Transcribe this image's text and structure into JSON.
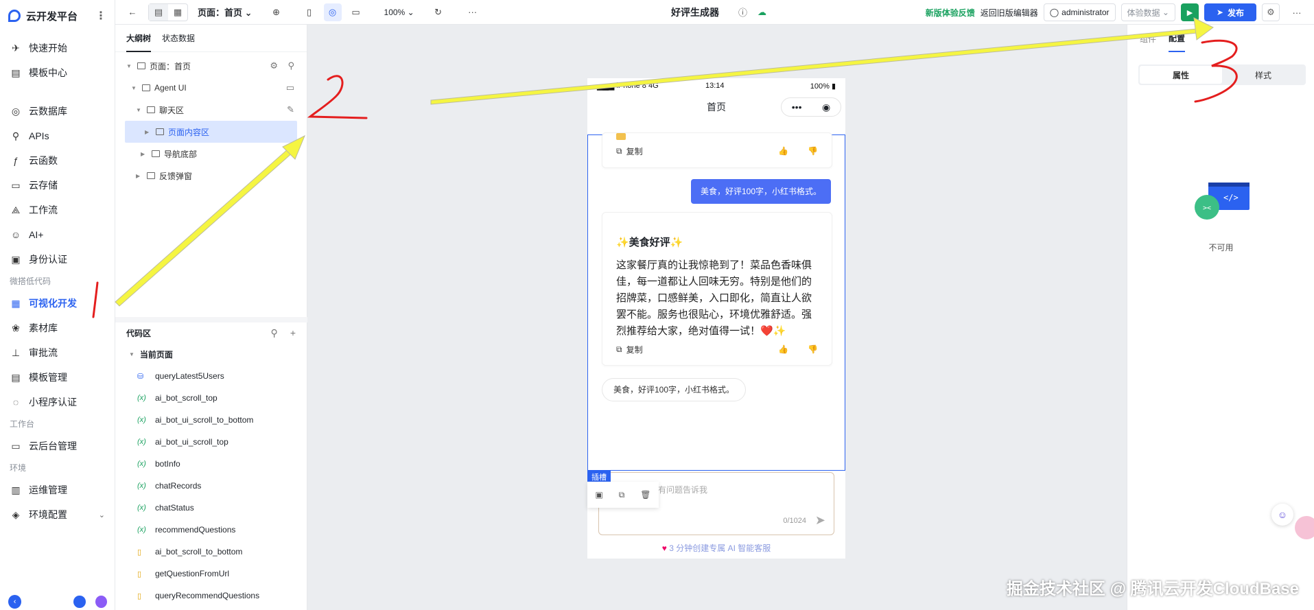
{
  "nav": {
    "brand": "云开发平台",
    "items_top": [
      {
        "label": "快速开始",
        "icon": "rocket-icon",
        "glyph": "✈"
      },
      {
        "label": "模板中心",
        "icon": "template-icon",
        "glyph": "▤"
      }
    ],
    "items_main": [
      {
        "label": "云数据库",
        "icon": "database-icon",
        "glyph": "◎"
      },
      {
        "label": "APIs",
        "icon": "link-icon",
        "glyph": "⚲"
      },
      {
        "label": "云函数",
        "icon": "function-icon",
        "glyph": "ƒ"
      },
      {
        "label": "云存储",
        "icon": "storage-icon",
        "glyph": "▭"
      },
      {
        "label": "工作流",
        "icon": "workflow-icon",
        "glyph": "⟁"
      },
      {
        "label": "AI+",
        "icon": "robot-icon",
        "glyph": "☺"
      },
      {
        "label": "身份认证",
        "icon": "id-card-icon",
        "glyph": "▣"
      }
    ],
    "section_lowcode": "微搭低代码",
    "items_lowcode": [
      {
        "label": "可视化开发",
        "icon": "visual-dev-icon",
        "glyph": "▦",
        "active": true
      },
      {
        "label": "素材库",
        "icon": "assets-icon",
        "glyph": "❀"
      },
      {
        "label": "审批流",
        "icon": "approval-icon",
        "glyph": "⊥"
      },
      {
        "label": "模板管理",
        "icon": "template-manage-icon",
        "glyph": "▤"
      },
      {
        "label": "小程序认证",
        "icon": "miniprogram-icon",
        "glyph": "◌"
      }
    ],
    "section_workbench": "工作台",
    "items_workbench": [
      {
        "label": "云后台管理",
        "icon": "monitor-icon",
        "glyph": "▭"
      }
    ],
    "section_env": "环境",
    "items_env": [
      {
        "label": "运维管理",
        "icon": "ops-chart-icon",
        "glyph": "▥"
      },
      {
        "label": "环境配置",
        "icon": "env-config-icon",
        "glyph": "◈"
      }
    ]
  },
  "toolbar": {
    "page_select": "页面：首页",
    "zoom": "100%",
    "title": "好评生成器",
    "feedback": "新版体验反馈",
    "old_editor": "返回旧版编辑器",
    "user": "administrator",
    "exp_data": "体验数据",
    "publish": "发布"
  },
  "outline": {
    "tab_tree": "大纲树",
    "tab_state": "状态数据",
    "nodes": [
      {
        "label": "页面：首页",
        "depth": 0
      },
      {
        "label": "Agent UI",
        "depth": 1
      },
      {
        "label": "聊天区",
        "depth": 2
      },
      {
        "label": "页面内容区",
        "depth": 3,
        "selected": true
      },
      {
        "label": "导航底部",
        "depth": 3
      },
      {
        "label": "反馈弹窗",
        "depth": 2
      }
    ]
  },
  "code": {
    "title": "代码区",
    "current_page": "当前页面",
    "items": [
      {
        "label": "queryLatest5Users",
        "kind": "db",
        "glyph": "⛁"
      },
      {
        "label": "ai_bot_scroll_top",
        "kind": "var",
        "glyph": "(x)"
      },
      {
        "label": "ai_bot_ui_scroll_to_bottom",
        "kind": "var",
        "glyph": "(x)"
      },
      {
        "label": "ai_bot_ui_scroll_top",
        "kind": "var",
        "glyph": "(x)"
      },
      {
        "label": "botInfo",
        "kind": "var",
        "glyph": "(x)"
      },
      {
        "label": "chatRecords",
        "kind": "var",
        "glyph": "(x)"
      },
      {
        "label": "chatStatus",
        "kind": "var",
        "glyph": "(x)"
      },
      {
        "label": "recommendQuestions",
        "kind": "var",
        "glyph": "(x)"
      },
      {
        "label": "ai_bot_scroll_to_bottom",
        "kind": "fn",
        "glyph": "▯"
      },
      {
        "label": "getQuestionFromUrl",
        "kind": "fn",
        "glyph": "▯"
      },
      {
        "label": "queryRecommendQuestions",
        "kind": "fn",
        "glyph": "▯"
      }
    ]
  },
  "phone": {
    "carrier": "iPhone 8",
    "network": "4G",
    "time": "13:14",
    "battery": "100%",
    "nav_title": "首页",
    "copy_label": "复制",
    "user_message": "美食，好评100字，小红书格式。",
    "ai_title": "✨美食好评✨",
    "ai_body": "这家餐厅真的让我惊艳到了！菜品色香味俱佳，每一道都让人回味无穷。特别是他们的招牌菜，口感鲜美，入口即化，简直让人欲罢不能。服务也很贴心，环境优雅舒适。强烈推荐给大家，绝对值得一试！❤️✨",
    "suggestion": "美食，好评100字，小红书格式。",
    "slot_tag": "插槽",
    "input_placeholder": "有问题告诉我",
    "input_count": "0/1024",
    "promo": "3 分钟创建专属 AI 智能客服"
  },
  "rpanel": {
    "tab_component": "组件",
    "tab_config": "配置",
    "seg_props": "属性",
    "seg_style": "样式",
    "empty": "不可用"
  },
  "annotations": {
    "mark1": "1",
    "mark2": "2",
    "mark3": "3"
  },
  "watermark": "掘金技术社区 @ 腾讯云开发CloudBase",
  "colors": {
    "primary": "#2b62f0",
    "success": "#19a15f",
    "highlight": "#dbe6ff",
    "arrow": "#f5f542",
    "annotation": "#e41e1e"
  }
}
